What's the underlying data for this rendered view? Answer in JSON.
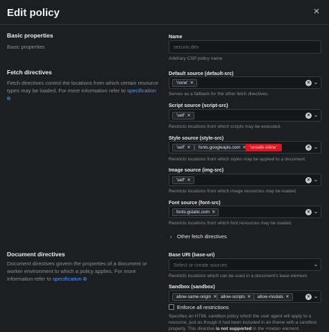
{
  "header": {
    "title": "Edit policy",
    "close_glyph": "×"
  },
  "basic": {
    "title": "Basic properties",
    "desc": "Basic properties"
  },
  "name": {
    "label": "Name",
    "value": "securis.dev",
    "help": "Arbitrary CSP policy name"
  },
  "fetch": {
    "title": "Fetch directives",
    "desc": "Fetch directives control the locations from which certain resource types may be loaded. For more information refer to ",
    "link": "specification",
    "default_src": {
      "label": "Default source (default-src)",
      "chips": [
        "'none'"
      ],
      "help": "Serves as a fallback for the other fetch directives."
    },
    "script_src": {
      "label": "Script source (script-src)",
      "chips": [
        "'self'"
      ],
      "help": "Restricts locations from which scripts may be executed."
    },
    "style_src": {
      "label": "Style source (style-src)",
      "chips": [
        "'self'",
        "fonts.googleapis.com",
        "'unsafe-inline'"
      ],
      "help": "Restricts locations from which styles may be applied to a document."
    },
    "img_src": {
      "label": "Image source (img-src)",
      "chips": [
        "'self'"
      ],
      "help": "Restricts locations from which image resources may be loaded."
    },
    "font_src": {
      "label": "Font source (font-src)",
      "chips": [
        "fonts.gstatic.com"
      ],
      "help": "Restricts locations from which font resources may be loaded."
    },
    "other": "Other fetch directives"
  },
  "document": {
    "title": "Document directives",
    "desc": "Document directives govern the properties of a document or worker environment to which a policy applies. For more information refer to ",
    "link": "specification",
    "base_uri": {
      "label": "Base URI (base-uri)",
      "placeholder": "Select or create sources",
      "help": "Restricts locations which can be used in a document's base element."
    },
    "sandbox": {
      "label": "Sandbox (sandbox)",
      "chips": [
        "allow-same-origin",
        "allow-scripts",
        "allow-modals"
      ],
      "checkbox": "Enforce all restrictions",
      "help_1": "Specifies an HTML sandbox policy which the user agent will apply to a resource, just as though it had been included in an iframe with a sandbox property. This directive ",
      "help_bold": "is not supported",
      "help_2": " in the <meta> element."
    }
  },
  "icons": {
    "clear": "clear-circle-icon",
    "chevron": "chevron-down-icon",
    "external": "external-link-icon"
  },
  "colors": {
    "background": "#1d1e22",
    "link": "#4a9dff",
    "danger_chip": "#e0141f"
  }
}
